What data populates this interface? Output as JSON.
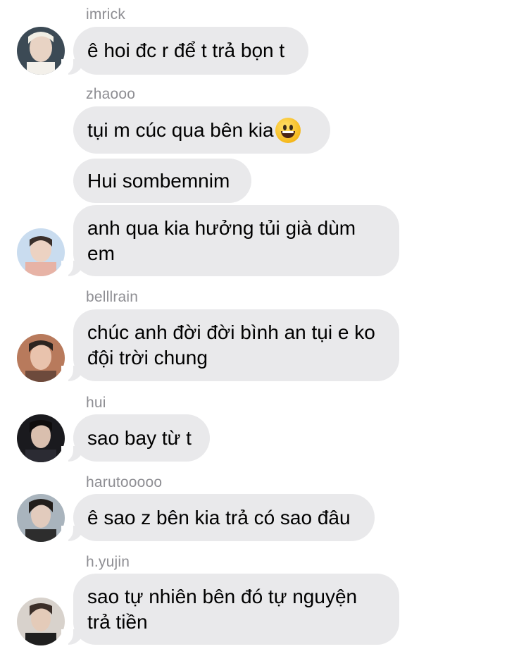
{
  "messages": [
    {
      "name": "imrick",
      "texts": [
        "ê hoi đc r để t trả bọn t"
      ]
    },
    {
      "name": "zhaooo",
      "texts": [
        "tụi m cúc qua bên kia",
        "Hui sombemnim",
        "anh qua kia hưởng tủi già dùm\nem"
      ],
      "emoji": "grinning-face"
    },
    {
      "name": "belllrain",
      "texts": [
        "chúc anh đời đời bình an tụi e ko\nđội trời chung"
      ]
    },
    {
      "name": "hui",
      "texts": [
        "sao bay từ t"
      ]
    },
    {
      "name": "harutooooo",
      "texts": [
        "ê sao z bên kia trả có sao đâu"
      ]
    },
    {
      "name": "h.yujin",
      "texts": [
        "sao tự nhiên bên đó tự nguyện\ntrả tiền"
      ]
    }
  ],
  "colors": {
    "bubble": "#e9e9eb",
    "name": "#8e8e93",
    "text": "#000000"
  }
}
